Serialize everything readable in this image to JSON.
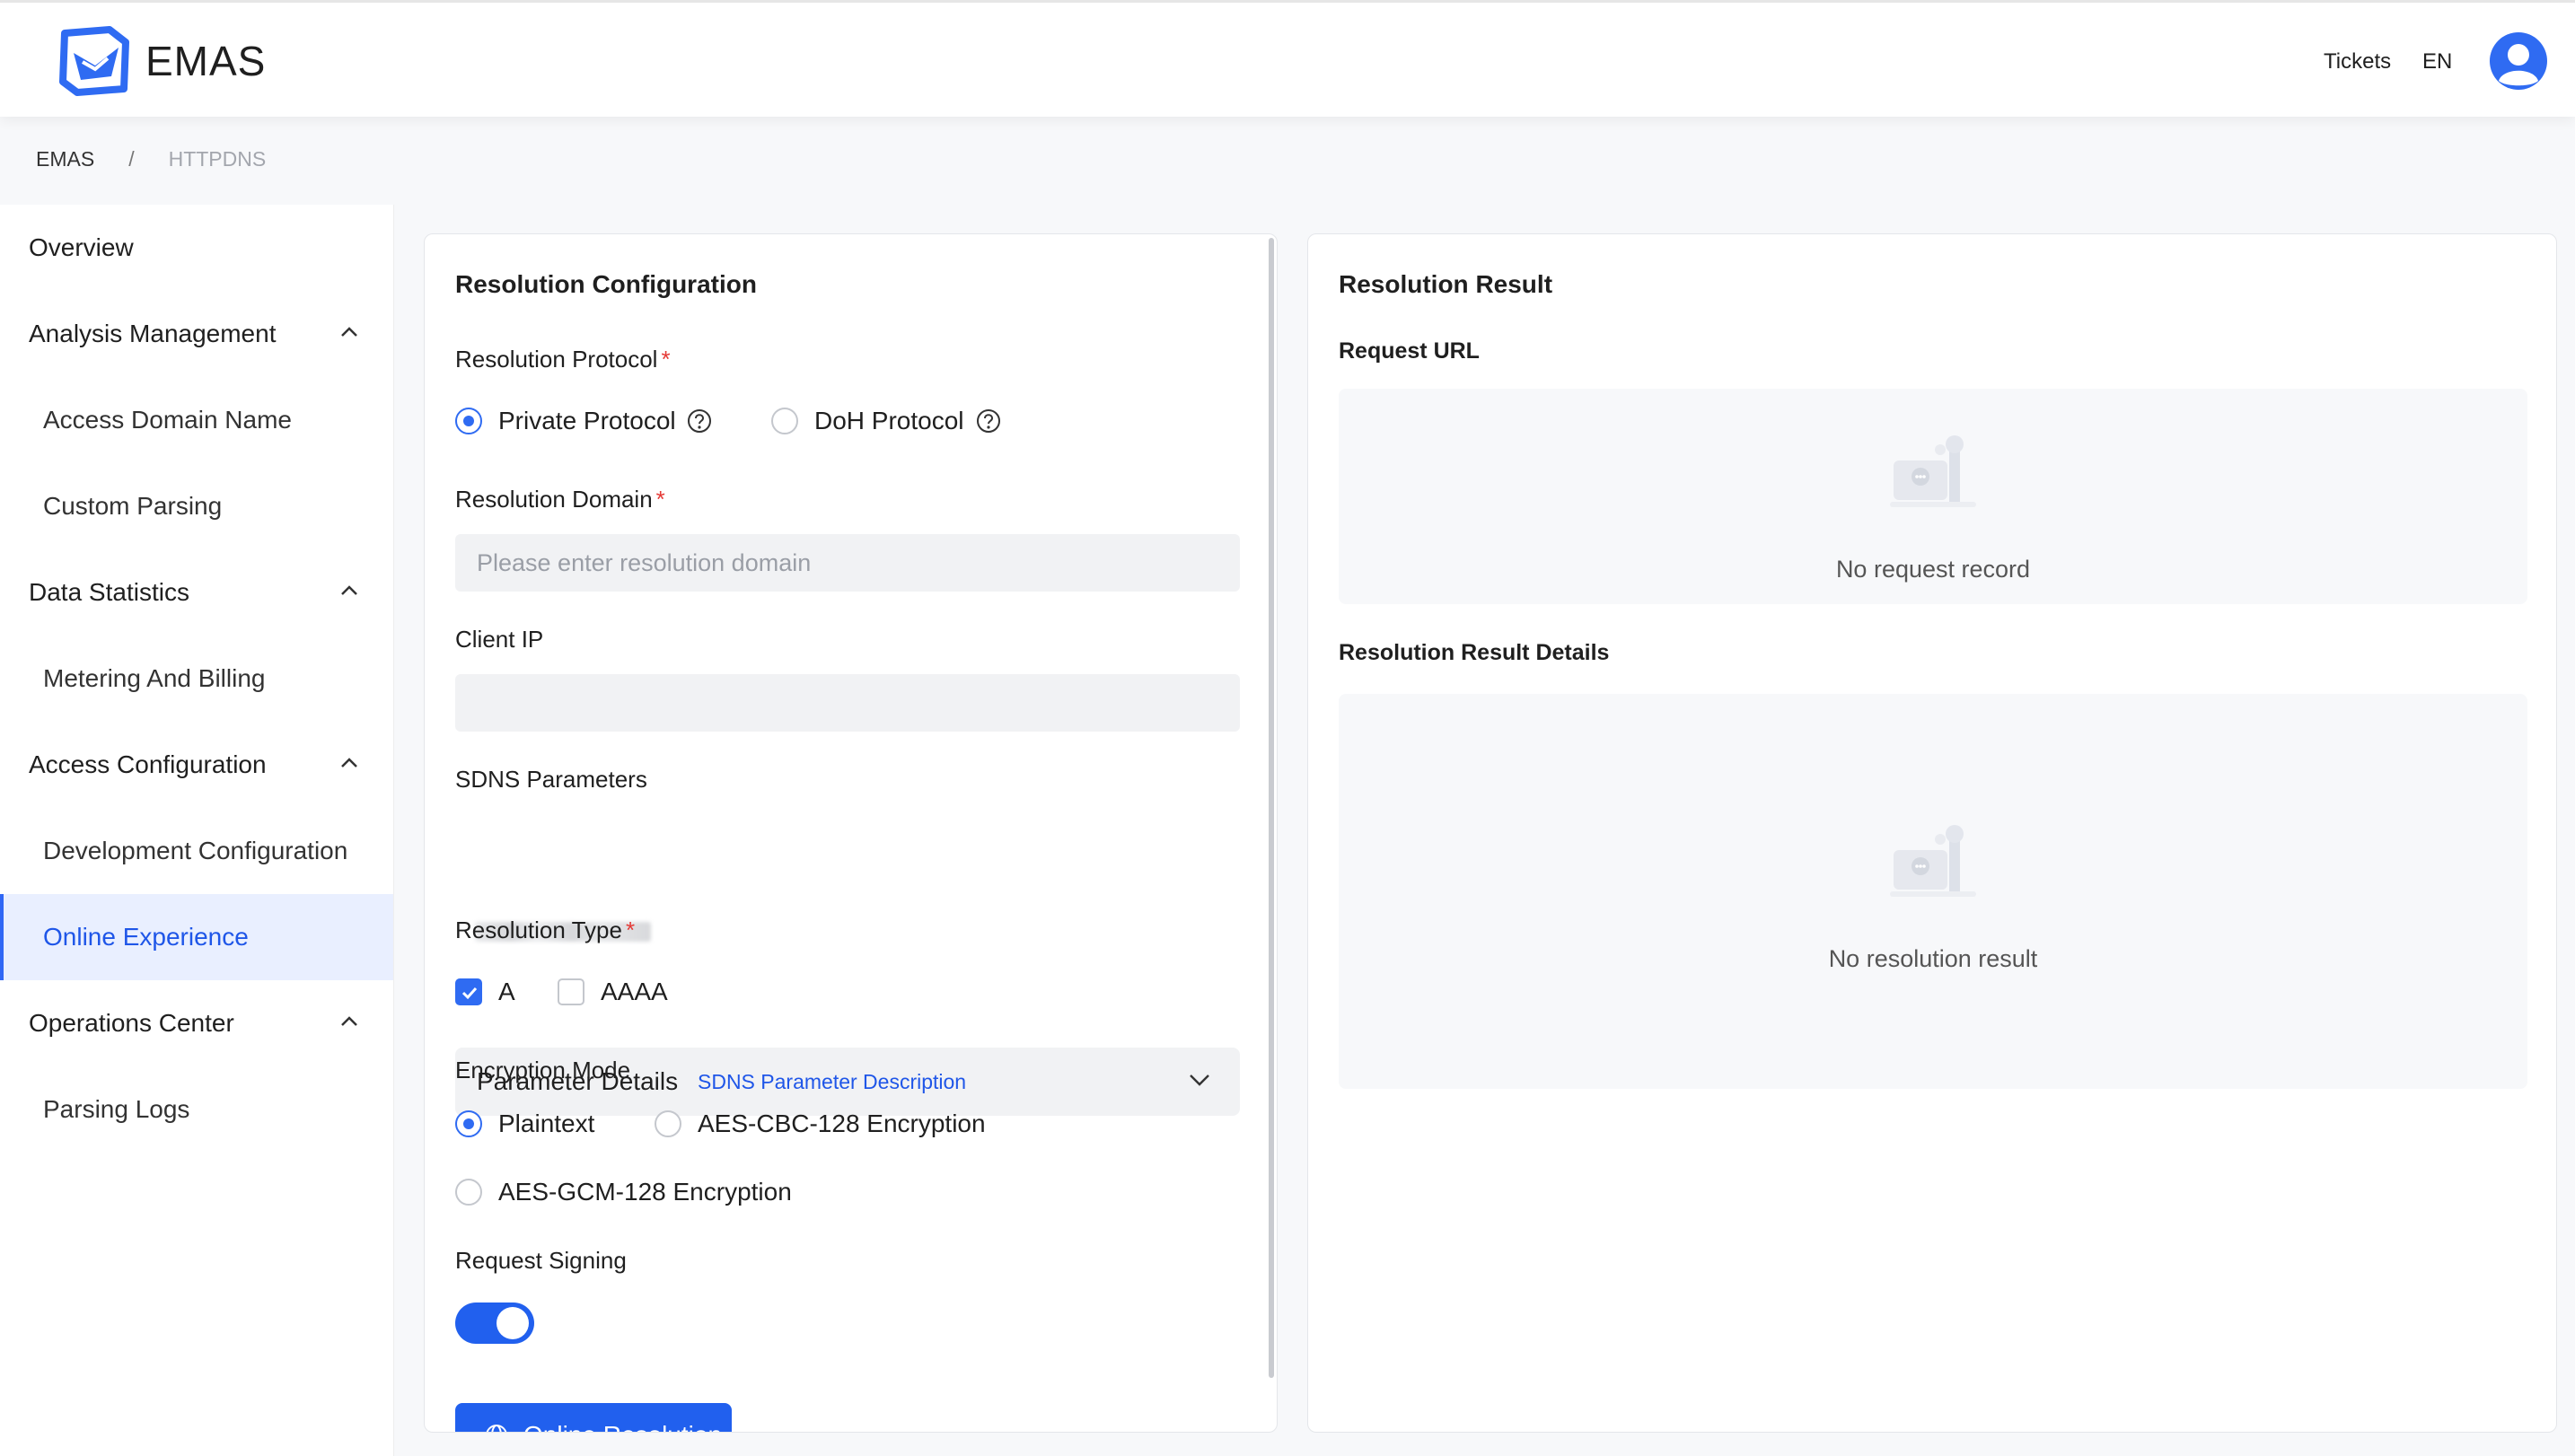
{
  "header": {
    "brand": "EMAS",
    "tickets": "Tickets",
    "language": "EN"
  },
  "breadcrumb": {
    "root": "EMAS",
    "separator": "/",
    "current": "HTTPDNS"
  },
  "sidebar": {
    "items": [
      {
        "label": "Overview"
      },
      {
        "label": "Analysis Management"
      },
      {
        "label": "Access Domain Name"
      },
      {
        "label": "Custom Parsing"
      },
      {
        "label": "Data Statistics"
      },
      {
        "label": "Metering And Billing"
      },
      {
        "label": "Access Configuration"
      },
      {
        "label": "Development Configuration"
      },
      {
        "label": "Online Experience"
      },
      {
        "label": "Operations Center"
      },
      {
        "label": "Parsing Logs"
      }
    ],
    "active": "Online Experience"
  },
  "config": {
    "title": "Resolution Configuration",
    "protocol_label": "Resolution Protocol",
    "required_mark": "*",
    "protocol_options": [
      "Private Protocol",
      "DoH Protocol"
    ],
    "protocol_selected": "Private Protocol",
    "domain_label": "Resolution Domain",
    "domain_placeholder": "Please enter resolution domain",
    "client_ip_label": "Client IP",
    "sdns_label": "SDNS Parameters",
    "sdns_panel_title": "Parameter Details",
    "sdns_link": "SDNS Parameter Description",
    "type_label": "Resolution Type",
    "type_options": [
      {
        "label": "A",
        "checked": true
      },
      {
        "label": "AAAA",
        "checked": false
      }
    ],
    "encryption_label": "Encryption Mode",
    "encryption_options": [
      "Plaintext",
      "AES-CBC-128 Encryption",
      "AES-GCM-128 Encryption"
    ],
    "encryption_selected": "Plaintext",
    "signing_label": "Request Signing",
    "signing_enabled": true,
    "submit_label": "Online Resolution"
  },
  "result": {
    "title": "Resolution Result",
    "request_url_label": "Request URL",
    "request_empty": "No request record",
    "details_label": "Resolution Result Details",
    "details_empty": "No resolution result"
  },
  "colors": {
    "accent": "#2160ee",
    "required": "#e53935",
    "active_bg": "#e9efff"
  }
}
